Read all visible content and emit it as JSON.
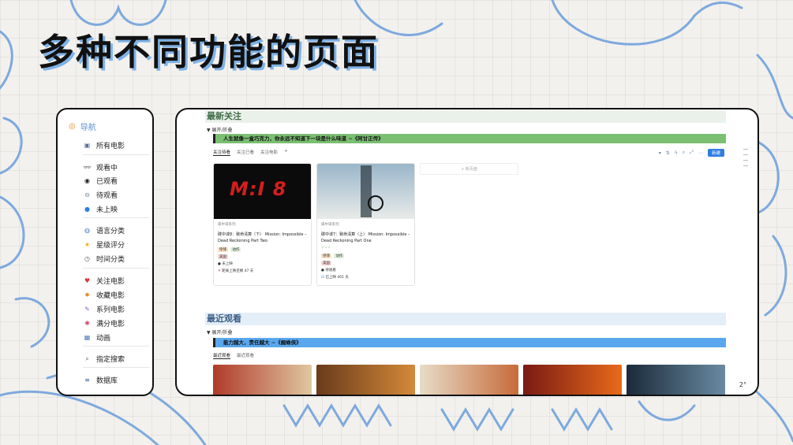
{
  "slide": {
    "title": "多种不同功能的页面"
  },
  "nav": {
    "header": "导航",
    "items": [
      {
        "label": "所有电影",
        "icon": "film-icon",
        "glyph": "▣",
        "color": "#5a6e9a"
      },
      {
        "label": "观看中",
        "icon": "glasses-icon",
        "glyph": "👓",
        "color": "#333"
      },
      {
        "label": "已观看",
        "icon": "sunglasses-icon",
        "glyph": "◉",
        "color": "#222"
      },
      {
        "label": "待观看",
        "icon": "eye-icon",
        "glyph": "⊖",
        "color": "#7a8aa0"
      },
      {
        "label": "未上映",
        "icon": "cc-icon",
        "glyph": "●",
        "color": "#2f7de1"
      },
      {
        "label": "语言分类",
        "icon": "globe-icon",
        "glyph": "◍",
        "color": "#4a7fc1"
      },
      {
        "label": "星级评分",
        "icon": "star-icon",
        "glyph": "★",
        "color": "#f2b01e"
      },
      {
        "label": "时间分类",
        "icon": "clock-icon",
        "glyph": "◷",
        "color": "#666"
      },
      {
        "label": "关注电影",
        "icon": "heart-icon",
        "glyph": "♥",
        "color": "#d9363e"
      },
      {
        "label": "收藏电影",
        "icon": "sparkle-icon",
        "glyph": "✸",
        "color": "#f08a24"
      },
      {
        "label": "系列电影",
        "icon": "dna-icon",
        "glyph": "✎",
        "color": "#8a63d2"
      },
      {
        "label": "满分电影",
        "icon": "fireworks-icon",
        "glyph": "✺",
        "color": "#d84a6b"
      },
      {
        "label": "动画",
        "icon": "frame-icon",
        "glyph": "▦",
        "color": "#4a7fc1"
      },
      {
        "label": "指定搜索",
        "icon": "search-icon",
        "glyph": "⌕",
        "color": "#555"
      },
      {
        "label": "数据库",
        "icon": "database-icon",
        "glyph": "≡",
        "color": "#4a6ea8"
      }
    ]
  },
  "main": {
    "section1": {
      "title": "最新关注",
      "toggle": "▼ 展开/折叠",
      "quote": "人生就像一盒巧克力，你永远不知道下一块是什么味道 ~《阿甘正传》",
      "tabs": [
        "关注待看",
        "关注已看",
        "关注电影",
        "+"
      ],
      "toolbar": {
        "new_label": "新建"
      },
      "add_card": "+ 新页面",
      "cards": [
        {
          "cover_text": "M:I 8",
          "series": "碟中谍系列",
          "title": "碟中谍8：致命清算（下） Mission: Impossible – Dead Reckoning Part Two",
          "rating": "",
          "tags": [
            "惊悚",
            "动作"
          ],
          "tag2": "美国",
          "status": "未上映",
          "release": "距离上映还剩 47 天"
        },
        {
          "cover_text": "",
          "series": "碟中谍系列",
          "title": "碟中谍7：致命清算（上） Mission: Impossible – Dead Reckoning Part One",
          "rating": "☆☆☆",
          "tags": [
            "惊悚",
            "动作"
          ],
          "tag2": "美国",
          "status": "待观看",
          "release": "已上映 401 天"
        }
      ]
    },
    "section2": {
      "title": "最近观看",
      "toggle": "▼ 展开/折叠",
      "quote": "能力越大，责任越大 ~《蜘蛛侠》",
      "tabs": [
        "最近观看",
        "最近观看"
      ]
    }
  },
  "page_number": "2°"
}
